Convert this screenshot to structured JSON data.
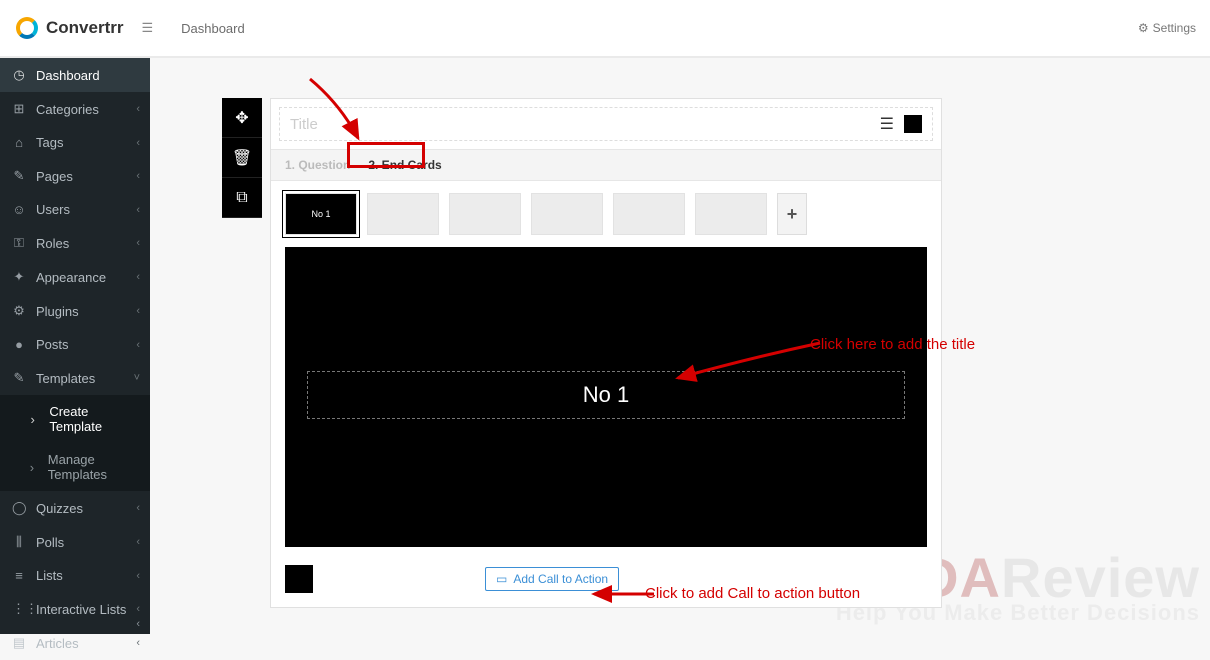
{
  "brand": "Convertrr",
  "breadcrumb": "Dashboard",
  "settings_label": "Settings",
  "sidebar": {
    "items": [
      {
        "icon": "◷",
        "label": "Dashboard",
        "chev": ""
      },
      {
        "icon": "⊞",
        "label": "Categories",
        "chev": "‹"
      },
      {
        "icon": "⌂",
        "label": "Tags",
        "chev": "‹"
      },
      {
        "icon": "✎",
        "label": "Pages",
        "chev": "‹"
      },
      {
        "icon": "☺",
        "label": "Users",
        "chev": "‹"
      },
      {
        "icon": "⚿",
        "label": "Roles",
        "chev": "‹"
      },
      {
        "icon": "✦",
        "label": "Appearance",
        "chev": "‹"
      },
      {
        "icon": "⚙",
        "label": "Plugins",
        "chev": "‹"
      },
      {
        "icon": "●",
        "label": "Posts",
        "chev": "‹"
      },
      {
        "icon": "✎",
        "label": "Templates",
        "chev": "˅"
      },
      {
        "icon": "›",
        "label": "Create Template",
        "chev": ""
      },
      {
        "icon": "›",
        "label": "Manage Templates",
        "chev": ""
      },
      {
        "icon": "◯",
        "label": "Quizzes",
        "chev": "‹"
      },
      {
        "icon": "⫼",
        "label": "Polls",
        "chev": "‹"
      },
      {
        "icon": "≡",
        "label": "Lists",
        "chev": "‹"
      },
      {
        "icon": "⋮⋮",
        "label": "Interactive Lists",
        "chev": "‹"
      },
      {
        "icon": "▤",
        "label": "Articles",
        "chev": "‹"
      }
    ]
  },
  "title_placeholder": "Title",
  "tabs": {
    "q": "1. Question",
    "e": "2. End Cards"
  },
  "thumb_label": "No 1",
  "stage_title": "No 1",
  "add_plus": "+",
  "cta_label": "Add Call to Action",
  "annot1": "Click here to add the title",
  "annot2": "Click to add Call to action button",
  "watermark": {
    "big1": "HUDA",
    "big2": "Review",
    "sub": "Help You Make Better Decisions"
  }
}
